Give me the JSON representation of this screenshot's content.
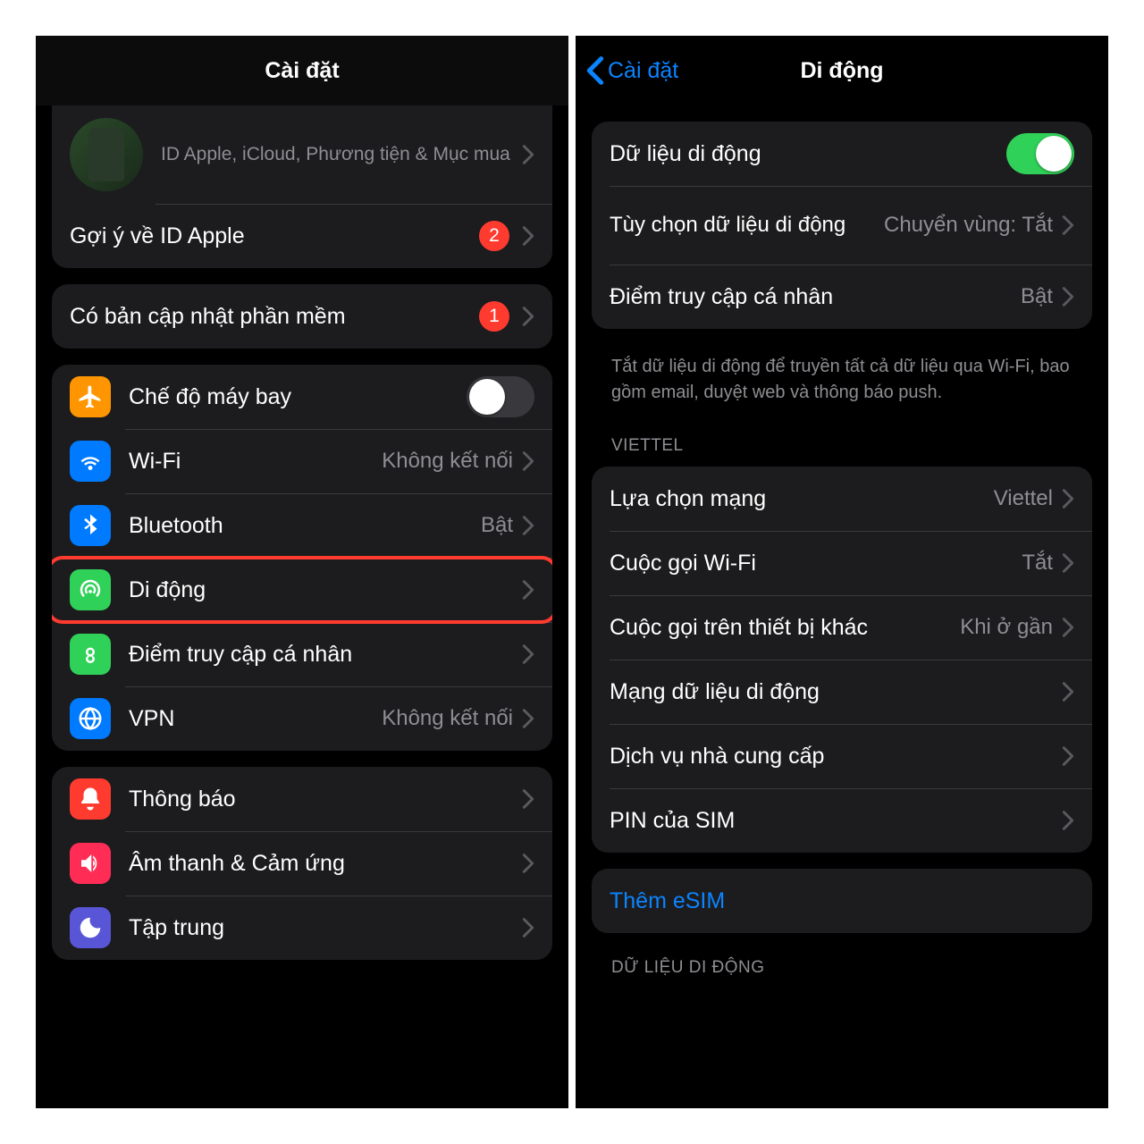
{
  "left": {
    "title": "Cài đặt",
    "profile_sub": "ID Apple, iCloud, Phương tiện & Mục mua",
    "apple_id_suggest": "Gợi ý về ID Apple",
    "apple_id_badge": "2",
    "software_update": "Có bản cập nhật phần mềm",
    "software_update_badge": "1",
    "airplane": "Chế độ máy bay",
    "wifi": "Wi-Fi",
    "wifi_value": "Không kết nối",
    "bluetooth": "Bluetooth",
    "bluetooth_value": "Bật",
    "cellular": "Di động",
    "hotspot": "Điểm truy cập cá nhân",
    "vpn": "VPN",
    "vpn_value": "Không kết nối",
    "notifications": "Thông báo",
    "sounds": "Âm thanh & Cảm ứng",
    "focus": "Tập trung"
  },
  "right": {
    "back": "Cài đặt",
    "title": "Di động",
    "mobile_data": "Dữ liệu di động",
    "data_options": "Tùy chọn dữ liệu di động",
    "data_options_value": "Chuyển vùng: Tắt",
    "hotspot": "Điểm truy cập cá nhân",
    "hotspot_value": "Bật",
    "footer": "Tắt dữ liệu di động để truyền tất cả dữ liệu qua Wi-Fi, bao gồm email, duyệt web và thông báo push.",
    "carrier_section": "VIETTEL",
    "network_select": "Lựa chọn mạng",
    "network_select_value": "Viettel",
    "wifi_calling": "Cuộc gọi Wi-Fi",
    "wifi_calling_value": "Tắt",
    "other_devices": "Cuộc gọi trên thiết bị khác",
    "other_devices_value": "Khi ở gần",
    "data_network": "Mạng dữ liệu di động",
    "carrier_services": "Dịch vụ nhà cung cấp",
    "sim_pin": "PIN của SIM",
    "add_esim": "Thêm eSIM",
    "data_section": "DỮ LIỆU DI ĐỘNG"
  }
}
